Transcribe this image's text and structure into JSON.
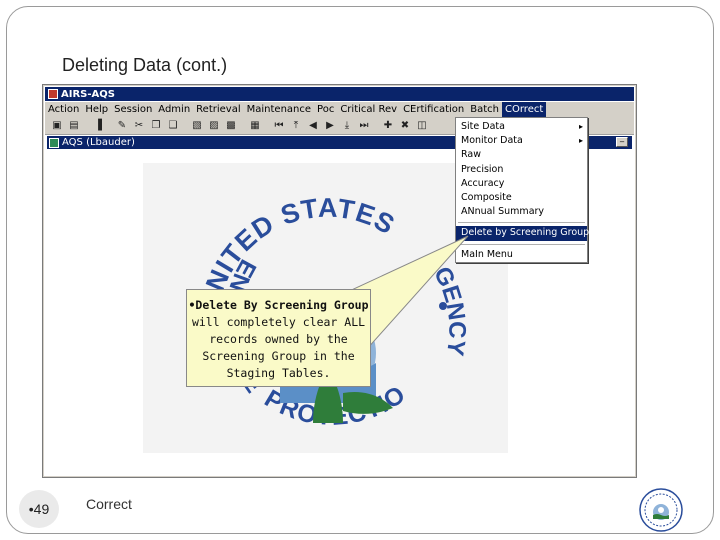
{
  "slide": {
    "title": "Deleting Data (cont.)",
    "number": "49",
    "footer": "Correct"
  },
  "window": {
    "title": "AIRS-AQS",
    "subwindow_title": "AQS (Lbauder)"
  },
  "menubar": {
    "items": [
      "Action",
      "Help",
      "Session",
      "Admin",
      "Retrieval",
      "Maintenance",
      "Poc",
      "Critical Rev",
      "CErtification",
      "Batch",
      "COrrect"
    ],
    "active": "COrrect"
  },
  "dropdown": {
    "items": [
      {
        "label": "Site Data",
        "submenu": true
      },
      {
        "label": "Monitor Data",
        "submenu": true
      },
      {
        "label": "Raw"
      },
      {
        "label": "Precision"
      },
      {
        "label": "Accuracy"
      },
      {
        "label": "Composite"
      },
      {
        "label": "ANnual Summary"
      },
      {
        "label": "Delete by Screening Group"
      },
      {
        "label": "MaIn Menu"
      }
    ],
    "highlighted": "Delete by Screening Group",
    "arrow": "▸"
  },
  "seal": {
    "top_text": "UNITED STATES",
    "left_text": "ENVIRONMENTAL",
    "bottom_text": "PROTECTION",
    "right_text": "AGENCY"
  },
  "callout": {
    "bold_text": "•Delete By Screening Group",
    "rest_text": " will completely clear ALL records owned by the Screening Group in the Staging Tables."
  },
  "colors": {
    "titlebar": "#0a246a",
    "chrome": "#d4d0c8",
    "callout_fill": "#fafac8",
    "seal_green": "#2f7d3a",
    "seal_blue": "#2a4d9b"
  }
}
